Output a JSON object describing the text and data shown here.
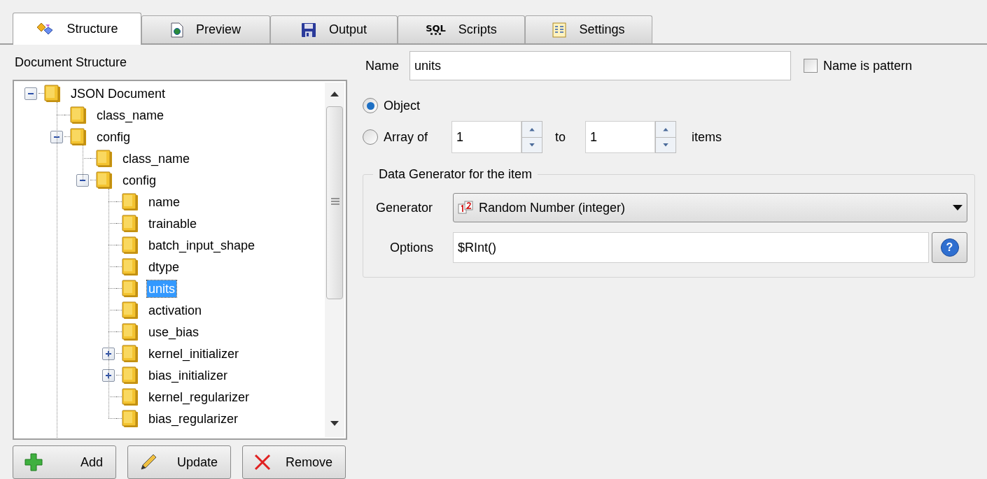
{
  "tabs": [
    {
      "label": "Structure",
      "kind": "structure",
      "selected": true
    },
    {
      "label": "Preview",
      "kind": "preview",
      "selected": false
    },
    {
      "label": "Output",
      "kind": "output",
      "selected": false
    },
    {
      "label": "SQL",
      "label2": "Scripts",
      "kind": "sql",
      "selected": false
    },
    {
      "label": "Settings",
      "kind": "settings",
      "selected": false
    }
  ],
  "tree_title": "Document Structure",
  "tree": [
    {
      "label": "JSON Document",
      "selected": false,
      "expanded": true,
      "children": [
        {
          "label": "class_name",
          "selected": false
        },
        {
          "label": "config",
          "selected": false,
          "expanded": true,
          "children": [
            {
              "label": "class_name",
              "selected": false
            },
            {
              "label": "config",
              "selected": false,
              "expanded": true,
              "children": [
                {
                  "label": "name",
                  "selected": false
                },
                {
                  "label": "trainable",
                  "selected": false
                },
                {
                  "label": "batch_input_shape",
                  "selected": false
                },
                {
                  "label": "dtype",
                  "selected": false
                },
                {
                  "label": "units",
                  "selected": true
                },
                {
                  "label": "activation",
                  "selected": false
                },
                {
                  "label": "use_bias",
                  "selected": false
                },
                {
                  "label": "kernel_initializer",
                  "selected": false,
                  "expanded": false
                },
                {
                  "label": "bias_initializer",
                  "selected": false,
                  "expanded": false
                },
                {
                  "label": "kernel_regularizer",
                  "selected": false
                },
                {
                  "label": "bias_regularizer",
                  "selected": false
                }
              ]
            }
          ]
        }
      ]
    }
  ],
  "buttons": [
    {
      "label": "Add",
      "kind": "add"
    },
    {
      "label": "Update",
      "kind": "update"
    },
    {
      "label": "Remove",
      "kind": "remove"
    }
  ],
  "name_label": "Name",
  "name_value": "units",
  "name_is_pattern": {
    "label": "Name is pattern",
    "checked": false
  },
  "radios": [
    {
      "label": "Object",
      "selected": true
    },
    {
      "label": "Array of",
      "selected": false
    }
  ],
  "array_from": "1",
  "array_to_label": "to",
  "array_to": "1",
  "array_items_label": "items",
  "group_title": "Data Generator for the item",
  "generator_label": "Generator",
  "generator_value": "Random Number (integer)",
  "options_label": "Options",
  "options_value": "$RInt()",
  "help_button": "?"
}
